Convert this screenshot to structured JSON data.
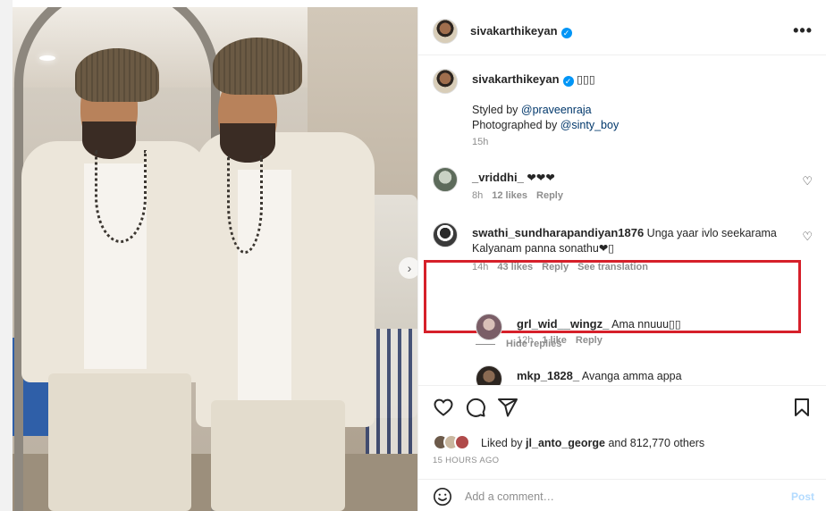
{
  "post": {
    "author": "sivakarthikeyan",
    "more_icon": "more-horizontal-icon",
    "caption": {
      "emoji_line": "▯▯▯",
      "styled_by_prefix": "Styled by ",
      "styled_by_handle": "@praveenraja",
      "photographed_by_prefix": "Photographed by ",
      "photographed_by_handle": "@sinty_boy",
      "time": "15h"
    },
    "comments": [
      {
        "user": "_vriddhi_",
        "text": "❤❤❤",
        "time": "8h",
        "likes": "12 likes",
        "reply": "Reply"
      },
      {
        "user": "swathi_sundharapandiyan1876",
        "text": "Unga yaar ivlo seekarama Kalyanam panna sonathu❤▯",
        "time": "14h",
        "likes": "43 likes",
        "reply": "Reply",
        "translate": "See translation",
        "highlighted": true
      }
    ],
    "hide_replies": "Hide replies",
    "replies": [
      {
        "user": "grl_wid__wingz_",
        "text": "Ama nnuuu▯▯",
        "time": "12h",
        "likes": "1 like",
        "reply": "Reply"
      },
      {
        "user": "mkp_1828_",
        "text": "Avanga amma appa"
      }
    ],
    "liked_by_prefix": "Liked by ",
    "liked_by_user": "jl_anto_george",
    "liked_by_suffix": " and 812,770 others",
    "posted_ago": "15 HOURS AGO",
    "comment_placeholder": "Add a comment…",
    "post_button": "Post"
  },
  "colors": {
    "accent": "#0095f6",
    "highlight_border": "#d6202a",
    "muted_text": "#8e8e8e",
    "link": "#00376b"
  }
}
